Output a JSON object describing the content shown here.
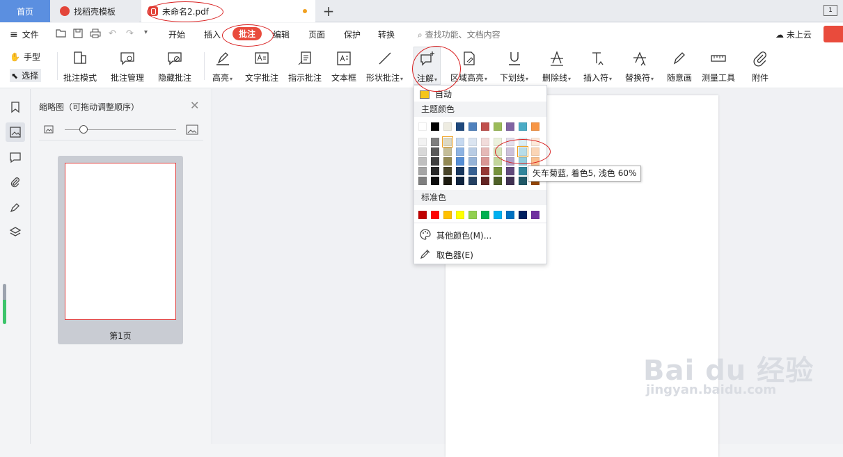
{
  "tabs": {
    "home": "首页",
    "doc": "找稻壳模板",
    "active": "未命名2.pdf",
    "add": "+"
  },
  "window": {
    "page_indicator": "1"
  },
  "menu": {
    "file": "文件",
    "items": [
      "开始",
      "插入",
      "批注",
      "编辑",
      "页面",
      "保护",
      "转换"
    ],
    "search_placeholder": "查找功能、文档内容",
    "cloud": "未上云"
  },
  "ribbon": {
    "hand": "手型",
    "select": "选择",
    "buttons": [
      "批注模式",
      "批注管理",
      "隐藏批注",
      "高亮",
      "文字批注",
      "指示批注",
      "文本框",
      "形状批注",
      "注解",
      "区域高亮",
      "下划线",
      "删除线",
      "插入符",
      "替换符",
      "随意画",
      "测量工具",
      "附件"
    ]
  },
  "thumbnail_panel": {
    "title": "缩略图（可拖动调整顺序）",
    "page_label": "第1页",
    "zoom_level": 0.2
  },
  "color_dropdown": {
    "auto": "自动",
    "theme_label": "主题颜色",
    "standard_label": "标准色",
    "more_colors": "其他颜色(M)...",
    "eyedropper": "取色器(E)",
    "theme_top": [
      "#ffffff",
      "#000000",
      "#eeece1",
      "#1f497d",
      "#4f81bd",
      "#c0504d",
      "#9bbb59",
      "#8064a2",
      "#4bacc6",
      "#f79646"
    ],
    "theme_grid": [
      [
        "#f2f2f2",
        "#7f7f7f",
        "#ddd9c3",
        "#c6d9f0",
        "#dbe5f1",
        "#f2dcdb",
        "#ebf1dd",
        "#e5e0ec",
        "#dbeef3",
        "#fdeada"
      ],
      [
        "#d8d8d8",
        "#595959",
        "#c4bd97",
        "#8db3e2",
        "#b8cce4",
        "#e5b9b7",
        "#d7e3bc",
        "#ccc1d9",
        "#b7dde8",
        "#fbd5b5"
      ],
      [
        "#bfbfbf",
        "#3f3f3f",
        "#938953",
        "#548dd4",
        "#95b3d7",
        "#d99694",
        "#c3d69b",
        "#b2a2c7",
        "#92cddc",
        "#fac08f"
      ],
      [
        "#a5a5a5",
        "#262626",
        "#494429",
        "#17365d",
        "#366092",
        "#953734",
        "#76923c",
        "#5f497a",
        "#31859b",
        "#e36c09"
      ],
      [
        "#7f7f7f",
        "#0c0c0c",
        "#1d1b10",
        "#0f243e",
        "#244061",
        "#632423",
        "#4f6128",
        "#3f3151",
        "#205867",
        "#974806"
      ]
    ],
    "standard": [
      "#c00000",
      "#ff0000",
      "#ffc000",
      "#ffff00",
      "#92d050",
      "#00b050",
      "#00b0f0",
      "#0070c0",
      "#002060",
      "#7030a0"
    ],
    "tooltip": "矢车菊蓝, 着色5, 浅色 60%"
  },
  "watermark": {
    "big": "Bai du 经验",
    "small": "jingyan.baidu.com"
  }
}
